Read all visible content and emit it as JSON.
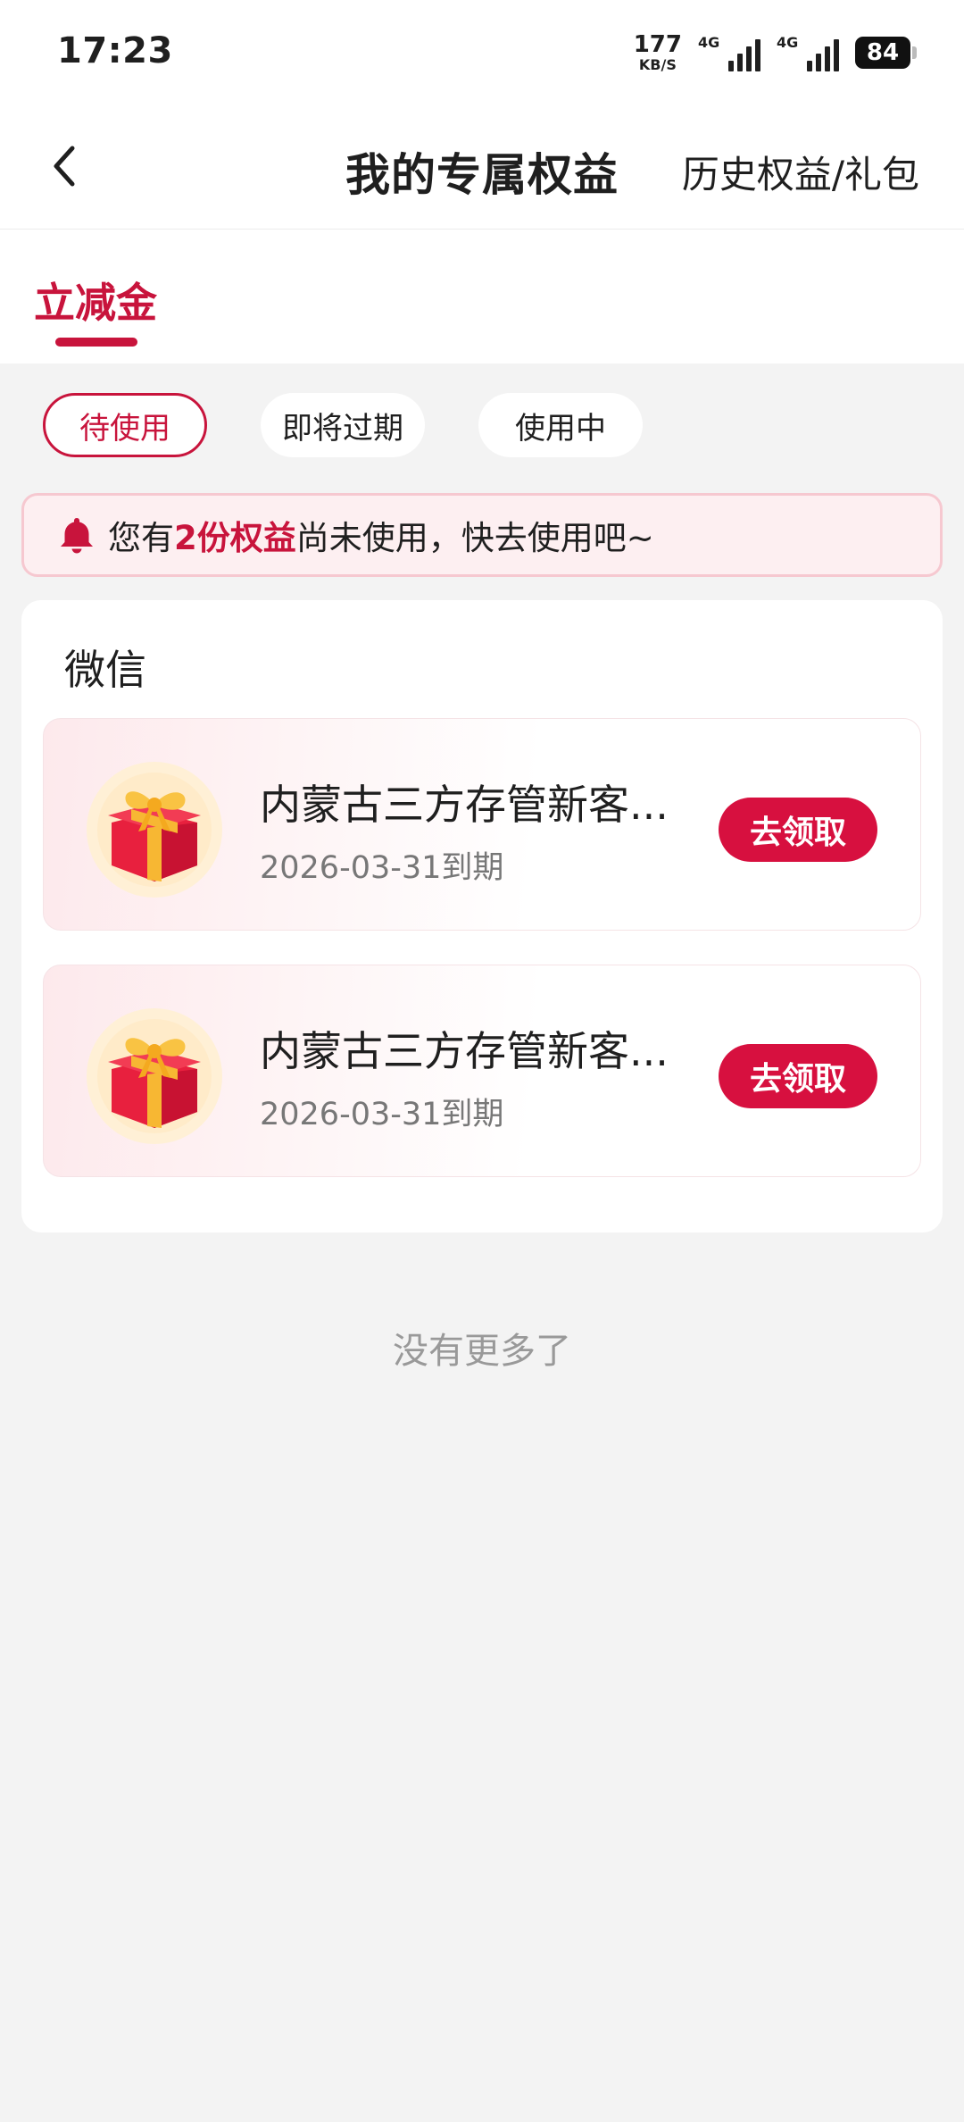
{
  "status_bar": {
    "time": "17:23",
    "net_speed_value": "177",
    "net_speed_unit": "KB/S",
    "signal_1_label": "4G",
    "signal_2_label": "4G",
    "battery": "84"
  },
  "nav": {
    "title": "我的专属权益",
    "history_link": "历史权益/礼包"
  },
  "main_tab": {
    "label": "立减金"
  },
  "filters": [
    {
      "label": "待使用",
      "active": true
    },
    {
      "label": "即将过期",
      "active": false
    },
    {
      "label": "使用中",
      "active": false
    }
  ],
  "notice": {
    "prefix": "您有",
    "highlight": "2份权益",
    "suffix": "尚未使用，快去使用吧~"
  },
  "card": {
    "title": "微信",
    "items": [
      {
        "name": "内蒙古三方存管新客...",
        "expiry": "2026-03-31到期",
        "button": "去领取"
      },
      {
        "name": "内蒙古三方存管新客...",
        "expiry": "2026-03-31到期",
        "button": "去领取"
      }
    ]
  },
  "footer": {
    "no_more": "没有更多了"
  },
  "colors": {
    "accent": "#c8143c",
    "button": "#d7103f",
    "background": "#f3f3f3"
  }
}
